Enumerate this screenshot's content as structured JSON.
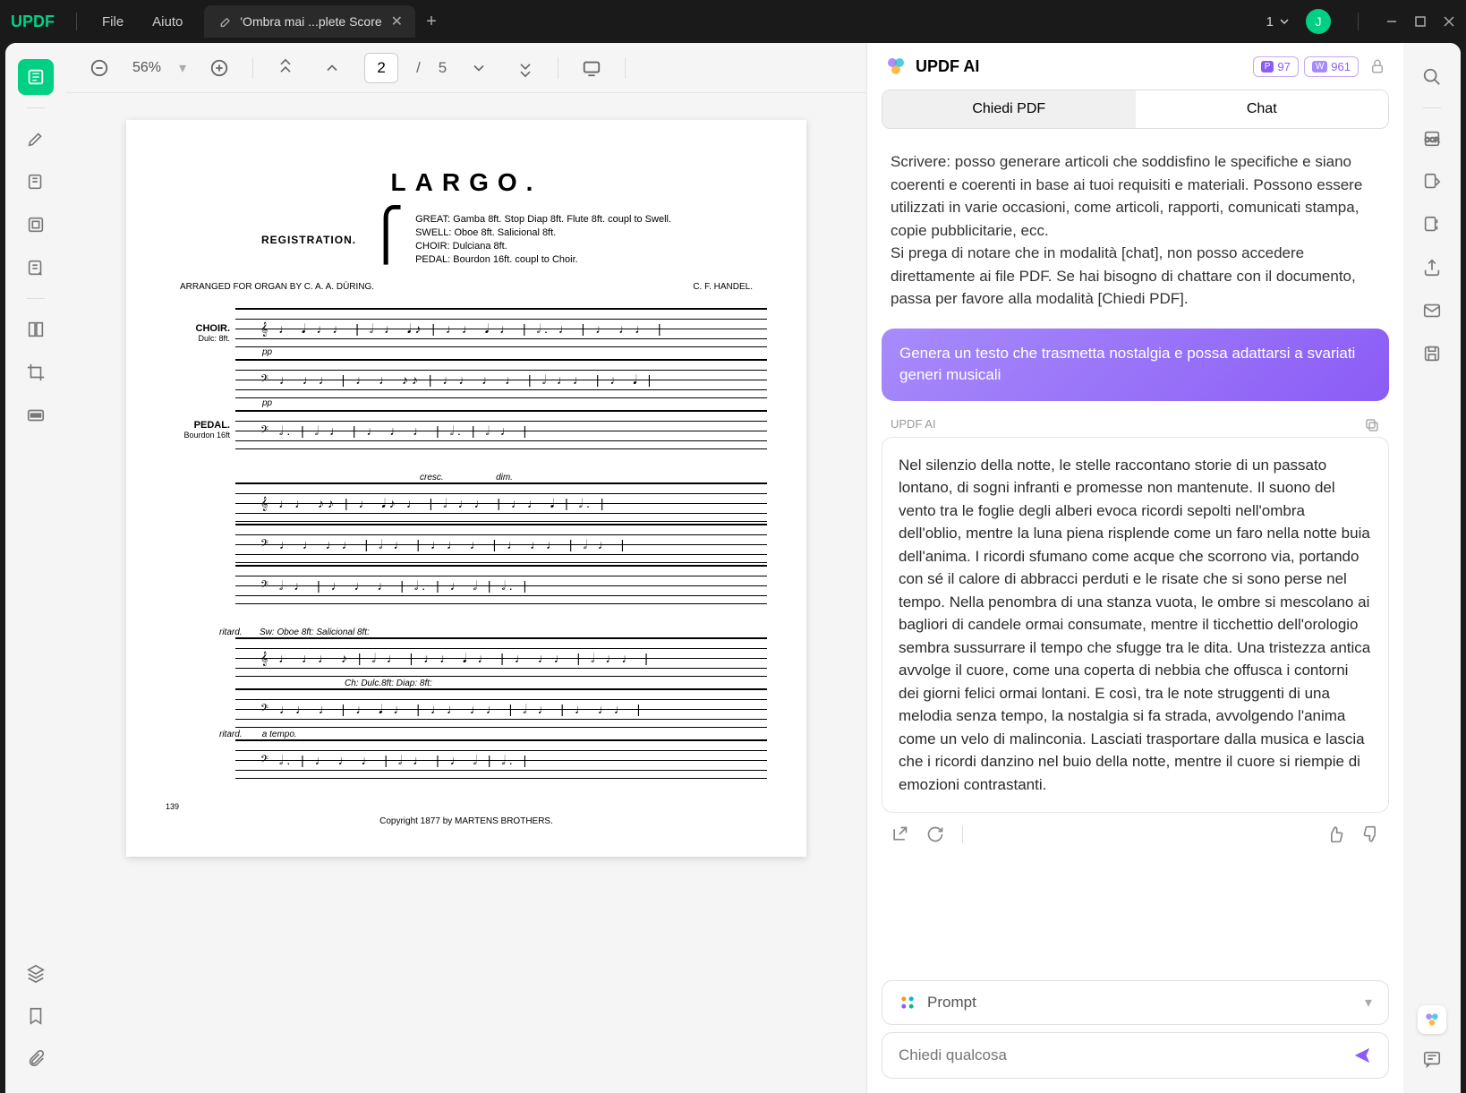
{
  "titlebar": {
    "logo": "UPDF",
    "menu": {
      "file": "File",
      "help": "Aiuto"
    },
    "tab": {
      "title": "'Ombra mai ...plete Score"
    },
    "page_indicator": "1",
    "avatar_letter": "J"
  },
  "toolbar": {
    "zoom": "56%",
    "page_current": "2",
    "page_sep": "/",
    "page_total": "5"
  },
  "document": {
    "title": "LARGO.",
    "registration_label": "REGISTRATION.",
    "registration": {
      "great": "GREAT: Gamba 8ft. Stop Diap 8ft. Flute 8ft. coupl to Swell.",
      "swell": "SWELL: Oboe 8ft. Salicional 8ft.",
      "choir": "CHOIR: Dulciana 8ft.",
      "pedal": "PEDAL: Bourdon 16ft. coupl to Choir."
    },
    "arranger": "ARRANGED FOR ORGAN BY C. A. A. DÜRING.",
    "composer": "C. F. HANDEL.",
    "instruments": {
      "choir": "CHOIR.",
      "dulc": "Dulc: 8ft.",
      "pedal": "PEDAL.",
      "bourdon": "Bourdon 16ft"
    },
    "expressions": {
      "pp": "pp",
      "cresc": "cresc.",
      "dim": "dim.",
      "ritard": "ritard.",
      "atempo": "a tempo.",
      "sw_oboe": "Sw: Oboe 8ft: Salicional 8ft:",
      "ch_dulc": "Ch: Dulc.8ft: Diap: 8ft:"
    },
    "page_number": "139",
    "copyright": "Copyright 1877 by MARTENS BROTHERS."
  },
  "ai": {
    "brand": "UPDF AI",
    "badges": {
      "p1_label": "P",
      "p1_val": "97",
      "p2_label": "W",
      "p2_val": "961"
    },
    "tabs": {
      "pdf": "Chiedi PDF",
      "chat": "Chat"
    },
    "prev_msg": "Scrivere: posso generare articoli che soddisfino le specifiche e siano coerenti e coerenti in base ai tuoi requisiti e materiali. Possono essere utilizzati in varie occasioni, come articoli, rapporti, comunicati stampa, copie pubblicitarie, ecc.",
    "prev_msg2": "Si prega di notare che in modalità [chat], non posso accedere direttamente ai file PDF. Se hai bisogno di chattare con il documento, passa per favore alla modalità [Chiedi PDF].",
    "user_msg": "Genera un testo che trasmetta nostalgia e possa adattarsi a svariati generi musicali",
    "ai_label": "UPDF AI",
    "response": "Nel silenzio della notte, le stelle raccontano storie di un passato lontano, di sogni infranti e promesse non mantenute. Il suono del vento tra le foglie degli alberi evoca ricordi sepolti nell'ombra dell'oblio, mentre la luna piena risplende come un faro nella notte buia dell'anima. I ricordi sfumano come acque che scorrono via, portando con sé il calore di abbracci perduti e le risate che si sono perse nel tempo. Nella penombra di una stanza vuota, le ombre si mescolano ai bagliori di candele ormai consumate, mentre il ticchettio dell'orologio sembra sussurrare il tempo che sfugge tra le dita. Una tristezza antica avvolge il cuore, come una coperta di nebbia che offusca i contorni dei giorni felici ormai lontani. E così, tra le note struggenti di una melodia senza tempo, la nostalgia si fa strada, avvolgendo l'anima come un velo di malinconia. Lasciati trasportare dalla musica e lascia che i ricordi danzino nel buio della notte, mentre il cuore si riempie di emozioni contrastanti.",
    "prompt_label": "Prompt",
    "input_placeholder": "Chiedi qualcosa"
  }
}
